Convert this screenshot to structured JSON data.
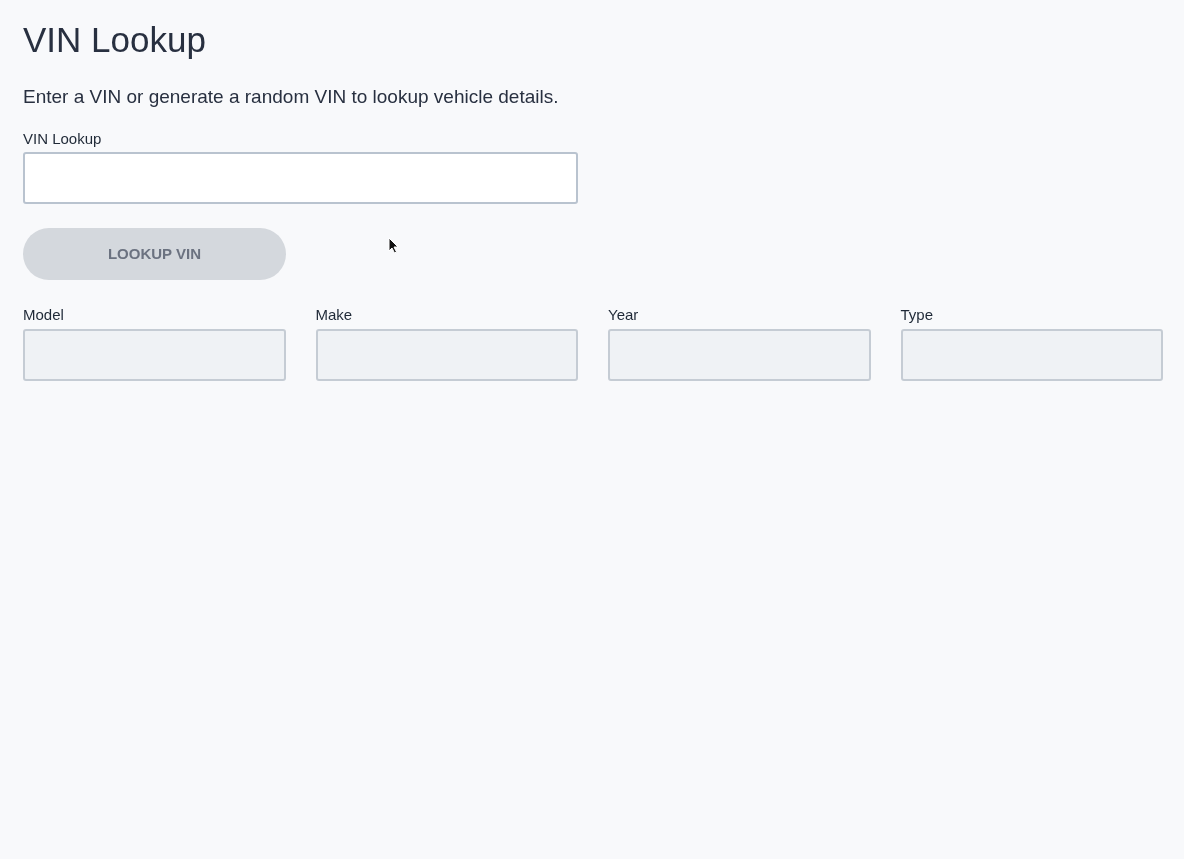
{
  "title": "VIN Lookup",
  "description": "Enter a VIN or generate a random VIN to lookup vehicle details.",
  "vin_field": {
    "label": "VIN Lookup",
    "disabled": false
  },
  "lookup_button": {
    "label": "LOOKUP VIN",
    "disabled": true
  },
  "detail_fields": [
    {
      "label": "Model",
      "disabled": true
    },
    {
      "label": "Make",
      "disabled": true
    },
    {
      "label": "Year",
      "disabled": true
    },
    {
      "label": "Type",
      "disabled": true
    }
  ]
}
